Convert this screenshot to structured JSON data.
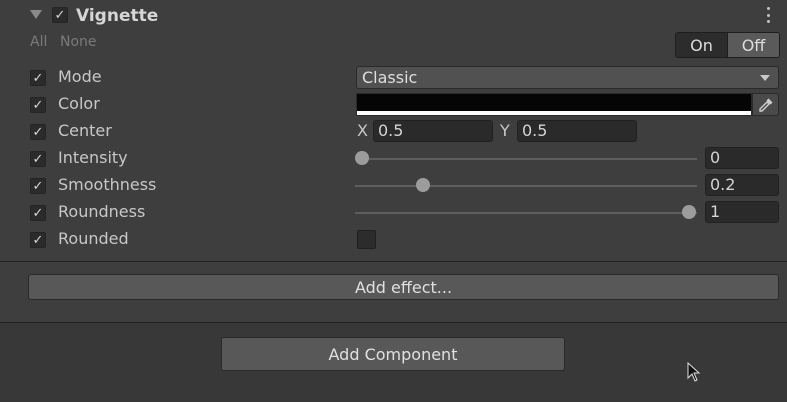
{
  "component": {
    "title": "Vignette",
    "enabled": true,
    "links": {
      "all": "All",
      "none": "None"
    },
    "toggle": {
      "on": "On",
      "off": "Off",
      "selected": "On"
    }
  },
  "rows": [
    {
      "label": "Mode",
      "checked": true
    },
    {
      "label": "Color",
      "checked": true
    },
    {
      "label": "Center",
      "checked": true
    },
    {
      "label": "Intensity",
      "checked": true
    },
    {
      "label": "Smoothness",
      "checked": true
    },
    {
      "label": "Roundness",
      "checked": true
    },
    {
      "label": "Rounded",
      "checked": true
    }
  ],
  "mode": {
    "value": "Classic"
  },
  "color": {
    "value": "#050505",
    "alpha": 1.0
  },
  "center": {
    "x_label": "X",
    "x": "0.5",
    "y_label": "Y",
    "y": "0.5"
  },
  "intensity": {
    "value": "0",
    "fraction": 0.0
  },
  "smoothness": {
    "value": "0.2",
    "fraction": 0.2
  },
  "roundness": {
    "value": "1",
    "fraction": 1.0
  },
  "rounded": {
    "checked": false
  },
  "buttons": {
    "add_effect": "Add effect...",
    "add_component": "Add Component"
  },
  "icons": {
    "foldout": "triangle-down-icon",
    "menu": "kebab-menu-icon",
    "picker": "eyedropper-icon",
    "check": "checkmark-icon",
    "cursor": "mouse-cursor-icon"
  }
}
